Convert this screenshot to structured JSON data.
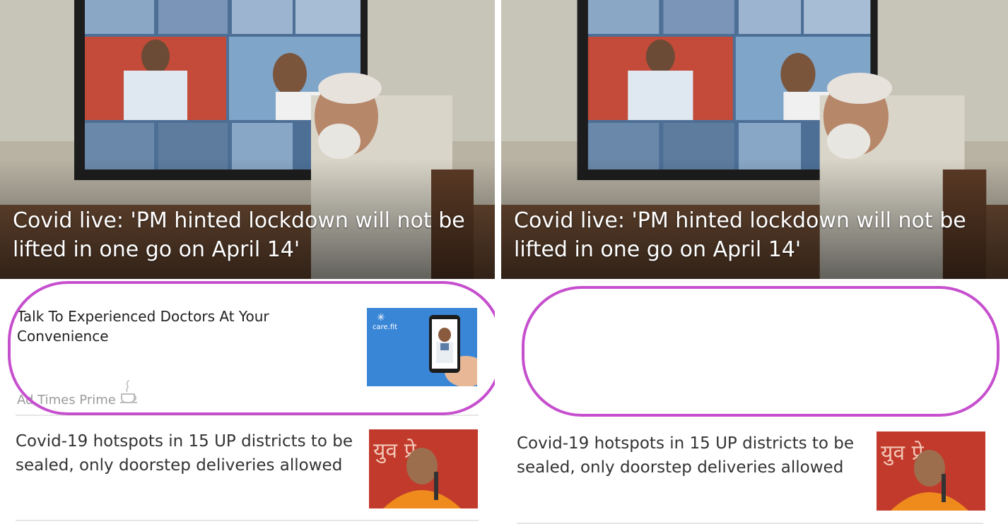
{
  "screens": {
    "before": {
      "hero": {
        "title": "Covid live: 'PM hinted lockdown will not be lifted in one go on April 14'"
      },
      "ad": {
        "title": "Talk To Experienced Doctors At Your Convenience",
        "meta": "Ad Times Prime",
        "brand": "care.fit"
      },
      "news": [
        {
          "title": "Covid-19 hotspots in 15 UP districts to be sealed, only doorstep deliveries allowed"
        }
      ]
    },
    "after": {
      "hero": {
        "title": "Covid live: 'PM hinted lockdown will not be lifted in one go on April 14'"
      },
      "news": [
        {
          "title": "Covid-19 hotspots in 15 UP districts to be sealed, only doorstep deliveries allowed"
        }
      ]
    }
  },
  "colors": {
    "highlight": "#c64fce",
    "ad_bg": "#3a86d6",
    "thumb_bg": "#c23a2b"
  },
  "icons": {
    "ad_cup": "coffee-cup-icon"
  }
}
